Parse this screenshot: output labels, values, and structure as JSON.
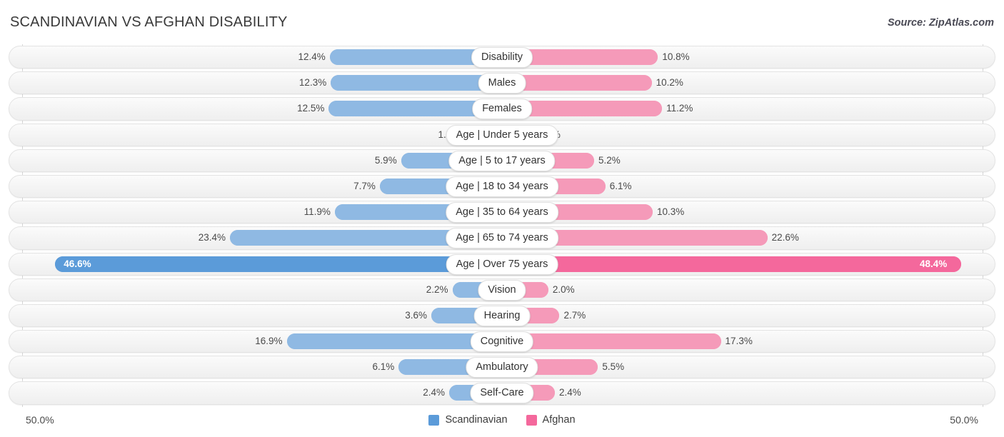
{
  "header": {
    "title": "SCANDINAVIAN VS AFGHAN DISABILITY",
    "source": "Source: ZipAtlas.com"
  },
  "axis": {
    "left_label": "50.0%",
    "right_label": "50.0%",
    "max": 50.0
  },
  "legend": {
    "items": [
      {
        "label": "Scandinavian",
        "color": "#5b9bd9",
        "icon": "square-swatch-icon"
      },
      {
        "label": "Afghan",
        "color": "#f4689c",
        "icon": "square-swatch-icon"
      }
    ]
  },
  "chart_data": {
    "type": "bar",
    "title": "SCANDINAVIAN VS AFGHAN DISABILITY",
    "subtitle": "Source: ZipAtlas.com",
    "orientation": "horizontal-diverging",
    "xlabel": "",
    "ylabel": "",
    "xlim": [
      50.0,
      50.0
    ],
    "grid": false,
    "legend_position": "bottom-center",
    "categories": [
      "Disability",
      "Males",
      "Females",
      "Age | Under 5 years",
      "Age | 5 to 17 years",
      "Age | 18 to 34 years",
      "Age | 35 to 64 years",
      "Age | 65 to 74 years",
      "Age | Over 75 years",
      "Vision",
      "Hearing",
      "Cognitive",
      "Ambulatory",
      "Self-Care"
    ],
    "series": [
      {
        "name": "Scandinavian",
        "color": "#8fb9e3",
        "values": [
          12.4,
          12.3,
          12.5,
          1.5,
          5.9,
          7.7,
          11.9,
          23.4,
          46.6,
          2.2,
          3.6,
          16.9,
          6.1,
          2.4
        ],
        "labels": [
          "12.4%",
          "12.3%",
          "12.5%",
          "1.5%",
          "5.9%",
          "7.7%",
          "11.9%",
          "23.4%",
          "46.6%",
          "2.2%",
          "3.6%",
          "16.9%",
          "6.1%",
          "2.4%"
        ]
      },
      {
        "name": "Afghan",
        "color": "#f59ab9",
        "values": [
          10.8,
          10.2,
          11.2,
          0.94,
          5.2,
          6.1,
          10.3,
          22.6,
          48.4,
          2.0,
          2.7,
          17.3,
          5.5,
          2.4
        ],
        "labels": [
          "10.8%",
          "10.2%",
          "11.2%",
          "0.94%",
          "5.2%",
          "6.1%",
          "10.3%",
          "22.6%",
          "48.4%",
          "2.0%",
          "2.7%",
          "17.3%",
          "5.5%",
          "2.4%"
        ]
      }
    ],
    "highlight_row_index": 8
  },
  "rows": [
    {
      "label": "Disability",
      "left": "12.4%",
      "right": "10.8%",
      "lv": 12.4,
      "rv": 10.8,
      "hi": false
    },
    {
      "label": "Males",
      "left": "12.3%",
      "right": "10.2%",
      "lv": 12.3,
      "rv": 10.2,
      "hi": false
    },
    {
      "label": "Females",
      "left": "12.5%",
      "right": "11.2%",
      "lv": 12.5,
      "rv": 11.2,
      "hi": false
    },
    {
      "label": "Age | Under 5 years",
      "left": "1.5%",
      "right": "0.94%",
      "lv": 1.5,
      "rv": 0.94,
      "hi": false
    },
    {
      "label": "Age | 5 to 17 years",
      "left": "5.9%",
      "right": "5.2%",
      "lv": 5.9,
      "rv": 5.2,
      "hi": false
    },
    {
      "label": "Age | 18 to 34 years",
      "left": "7.7%",
      "right": "6.1%",
      "lv": 7.7,
      "rv": 6.1,
      "hi": false
    },
    {
      "label": "Age | 35 to 64 years",
      "left": "11.9%",
      "right": "10.3%",
      "lv": 11.9,
      "rv": 10.3,
      "hi": false
    },
    {
      "label": "Age | 65 to 74 years",
      "left": "23.4%",
      "right": "22.6%",
      "lv": 23.4,
      "rv": 22.6,
      "hi": false
    },
    {
      "label": "Age | Over 75 years",
      "left": "46.6%",
      "right": "48.4%",
      "lv": 46.6,
      "rv": 48.4,
      "hi": true
    },
    {
      "label": "Vision",
      "left": "2.2%",
      "right": "2.0%",
      "lv": 2.2,
      "rv": 2.0,
      "hi": false
    },
    {
      "label": "Hearing",
      "left": "3.6%",
      "right": "2.7%",
      "lv": 3.6,
      "rv": 2.7,
      "hi": false
    },
    {
      "label": "Cognitive",
      "left": "16.9%",
      "right": "17.3%",
      "lv": 16.9,
      "rv": 17.3,
      "hi": false
    },
    {
      "label": "Ambulatory",
      "left": "6.1%",
      "right": "5.5%",
      "lv": 6.1,
      "rv": 5.5,
      "hi": false
    },
    {
      "label": "Self-Care",
      "left": "2.4%",
      "right": "2.4%",
      "lv": 2.4,
      "rv": 2.4,
      "hi": false
    }
  ]
}
